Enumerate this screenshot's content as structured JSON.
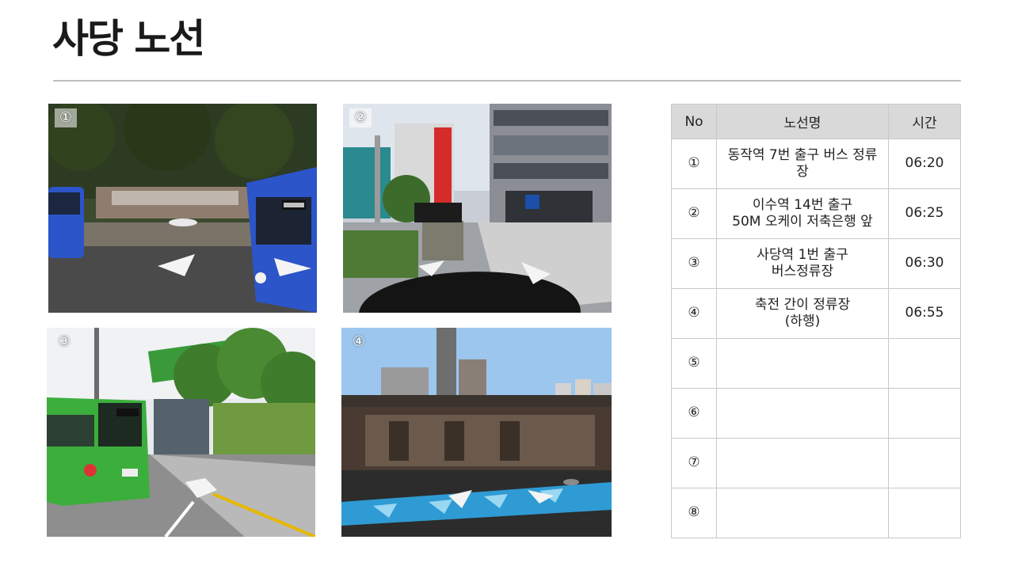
{
  "page": {
    "title": "사당 노선"
  },
  "photos": [
    {
      "number": "①",
      "scene": "bus-stop-street"
    },
    {
      "number": "②",
      "scene": "intersection-crosswalk"
    },
    {
      "number": "③",
      "scene": "green-bus-shelter"
    },
    {
      "number": "④",
      "scene": "bus-shelter-median"
    }
  ],
  "table": {
    "headers": {
      "no": "No",
      "route": "노선명",
      "time": "시간"
    },
    "rows": [
      {
        "no": "①",
        "route": "동작역 7번 출구 버스 정류\n장",
        "time": "06:20"
      },
      {
        "no": "②",
        "route": "이수역 14번 출구\n50M 오케이 저축은행 앞",
        "time": "06:25"
      },
      {
        "no": "③",
        "route": "사당역 1번 출구\n버스정류장",
        "time": "06:30"
      },
      {
        "no": "④",
        "route": "축전 간이 정류장\n(하행)",
        "time": "06:55"
      },
      {
        "no": "⑤",
        "route": "",
        "time": ""
      },
      {
        "no": "⑥",
        "route": "",
        "time": ""
      },
      {
        "no": "⑦",
        "route": "",
        "time": ""
      },
      {
        "no": "⑧",
        "route": "",
        "time": ""
      }
    ]
  },
  "colors": {
    "rule": "#bdbdbd",
    "header_bg": "#d9d9d9",
    "border": "#c8c8c8",
    "bus_blue": "#2b55c8",
    "bus_green": "#3cae3c"
  }
}
